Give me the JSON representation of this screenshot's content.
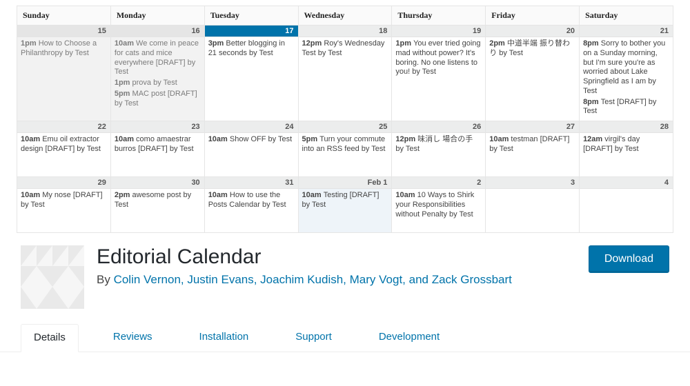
{
  "calendar": {
    "headers": [
      "Sunday",
      "Monday",
      "Tuesday",
      "Wednesday",
      "Thursday",
      "Friday",
      "Saturday"
    ],
    "weeks": [
      [
        {
          "label": "15",
          "cls": "past",
          "events": [
            {
              "time": "1pm",
              "text": "How to Choose a Philanthropy by Test"
            }
          ]
        },
        {
          "label": "16",
          "cls": "past",
          "events": [
            {
              "time": "10am",
              "text": "We come in peace for cats and mice everywhere [DRAFT] by Test"
            },
            {
              "time": "1pm",
              "text": "prova by Test"
            },
            {
              "time": "5pm",
              "text": "MAC post [DRAFT] by Test"
            }
          ]
        },
        {
          "label": "17",
          "cls": "today",
          "events": [
            {
              "time": "3pm",
              "text": "Better blogging in 21 seconds by Test"
            }
          ]
        },
        {
          "label": "18",
          "cls": "",
          "events": [
            {
              "time": "12pm",
              "text": "Roy's Wednesday Test by Test"
            }
          ]
        },
        {
          "label": "19",
          "cls": "",
          "events": [
            {
              "time": "1pm",
              "text": "You ever tried going mad without power? It's boring. No one listens to you! by Test"
            }
          ]
        },
        {
          "label": "20",
          "cls": "",
          "events": [
            {
              "time": "2pm",
              "text": "中道半端 振り替わり by Test"
            }
          ]
        },
        {
          "label": "21",
          "cls": "",
          "events": [
            {
              "time": "8pm",
              "text": "Sorry to bother you on a Sunday morning, but I'm sure you're as worried about Lake Springfield as I am by Test"
            },
            {
              "time": "8pm",
              "text": "Test [DRAFT] by Test"
            }
          ]
        }
      ],
      [
        {
          "label": "22",
          "cls": "",
          "events": [
            {
              "time": "10am",
              "text": "Emu oil extractor design [DRAFT] by Test"
            }
          ]
        },
        {
          "label": "23",
          "cls": "",
          "events": [
            {
              "time": "10am",
              "text": "como amaestrar burros [DRAFT] by Test"
            }
          ]
        },
        {
          "label": "24",
          "cls": "",
          "events": [
            {
              "time": "10am",
              "text": "Show OFF by Test"
            }
          ]
        },
        {
          "label": "25",
          "cls": "",
          "events": [
            {
              "time": "5pm",
              "text": "Turn your commute into an RSS feed by Test"
            }
          ]
        },
        {
          "label": "26",
          "cls": "",
          "events": [
            {
              "time": "12pm",
              "text": "味消し 場合の手 by Test"
            }
          ]
        },
        {
          "label": "27",
          "cls": "",
          "events": [
            {
              "time": "10am",
              "text": "testman [DRAFT] by Test"
            }
          ]
        },
        {
          "label": "28",
          "cls": "",
          "events": [
            {
              "time": "12am",
              "text": "virgil's day [DRAFT] by Test"
            }
          ]
        }
      ],
      [
        {
          "label": "29",
          "cls": "",
          "events": [
            {
              "time": "10am",
              "text": "My nose [DRAFT] by Test"
            }
          ]
        },
        {
          "label": "30",
          "cls": "",
          "events": [
            {
              "time": "2pm",
              "text": "awesome post by Test"
            }
          ]
        },
        {
          "label": "31",
          "cls": "",
          "events": [
            {
              "time": "10am",
              "text": "How to use the Posts Calendar by Test"
            }
          ]
        },
        {
          "label": "Feb 1",
          "cls": "feb1",
          "events": [
            {
              "time": "10am",
              "text": "Testing [DRAFT] by Test"
            }
          ]
        },
        {
          "label": "2",
          "cls": "",
          "events": [
            {
              "time": "10am",
              "text": "10 Ways to Shirk your Responsibilities without Penalty by Test"
            }
          ]
        },
        {
          "label": "3",
          "cls": "",
          "events": []
        },
        {
          "label": "4",
          "cls": "",
          "events": []
        }
      ]
    ]
  },
  "plugin": {
    "title": "Editorial Calendar",
    "by_prefix": "By ",
    "authors": "Colin Vernon, Justin Evans, Joachim Kudish, Mary Vogt, and Zack Grossbart",
    "download": "Download"
  },
  "tabs": [
    "Details",
    "Reviews",
    "Installation",
    "Support",
    "Development"
  ],
  "desc": ""
}
